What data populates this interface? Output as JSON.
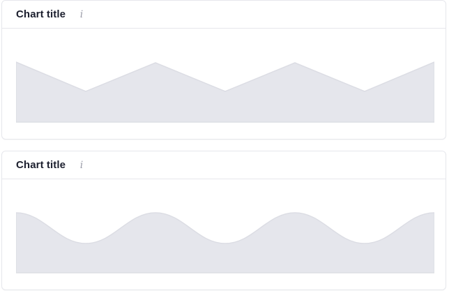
{
  "cards": [
    {
      "title": "Chart title",
      "info_icon": "info-icon",
      "placeholder_style": "zigzag"
    },
    {
      "title": "Chart title",
      "info_icon": "info-icon",
      "placeholder_style": "wave"
    }
  ],
  "colors": {
    "placeholder_fill": "#e5e6ec",
    "placeholder_stroke": "#dcdde4",
    "border": "#e6e7ec",
    "title": "#1c1f2e",
    "icon": "#9a9ca8"
  }
}
